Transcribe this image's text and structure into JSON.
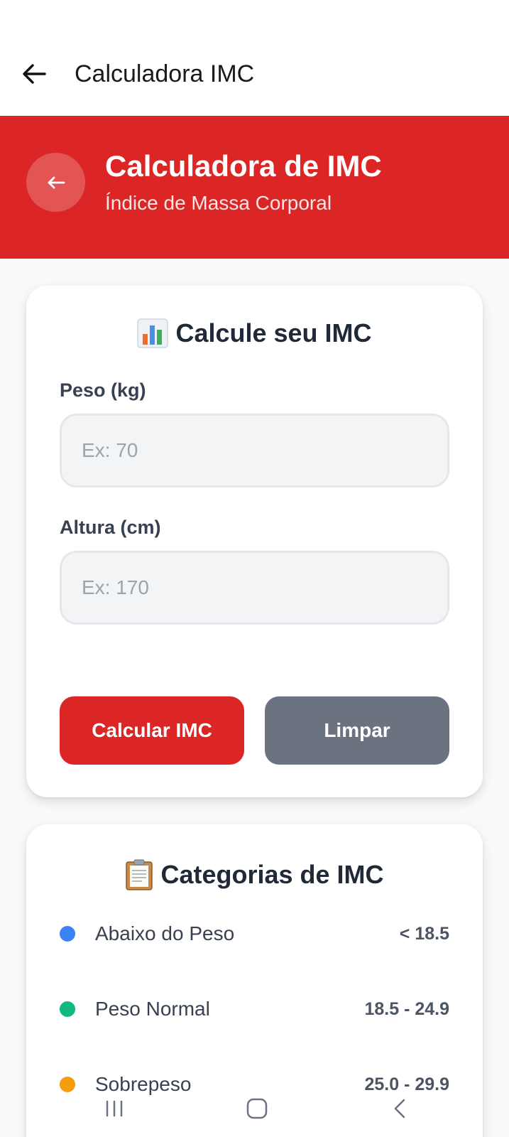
{
  "appbar": {
    "title": "Calculadora IMC",
    "back_icon": "arrow-left-icon"
  },
  "hero": {
    "back_icon": "arrow-left-icon",
    "title": "Calculadora de IMC",
    "subtitle": "Índice de Massa Corporal",
    "color": "#dc2626"
  },
  "calculator": {
    "title_icon": "bar-chart-icon",
    "title": "Calcule seu IMC",
    "weight": {
      "label": "Peso (kg)",
      "placeholder": "Ex: 70",
      "value": ""
    },
    "height": {
      "label": "Altura (cm)",
      "placeholder": "Ex: 170",
      "value": ""
    },
    "calculate_button": "Calcular IMC",
    "clear_button": "Limpar"
  },
  "categories": {
    "title_icon": "clipboard-icon",
    "title": "Categorias de IMC",
    "items": [
      {
        "name": "Abaixo do Peso",
        "range": "< 18.5",
        "color": "#3b82f6"
      },
      {
        "name": "Peso Normal",
        "range": "18.5 - 24.9",
        "color": "#10b981"
      },
      {
        "name": "Sobrepeso",
        "range": "25.0 - 29.9",
        "color": "#f59e0b"
      }
    ]
  },
  "system_nav": {
    "recents_icon": "recents-icon",
    "home_icon": "home-icon",
    "back_icon": "chevron-left-icon"
  }
}
